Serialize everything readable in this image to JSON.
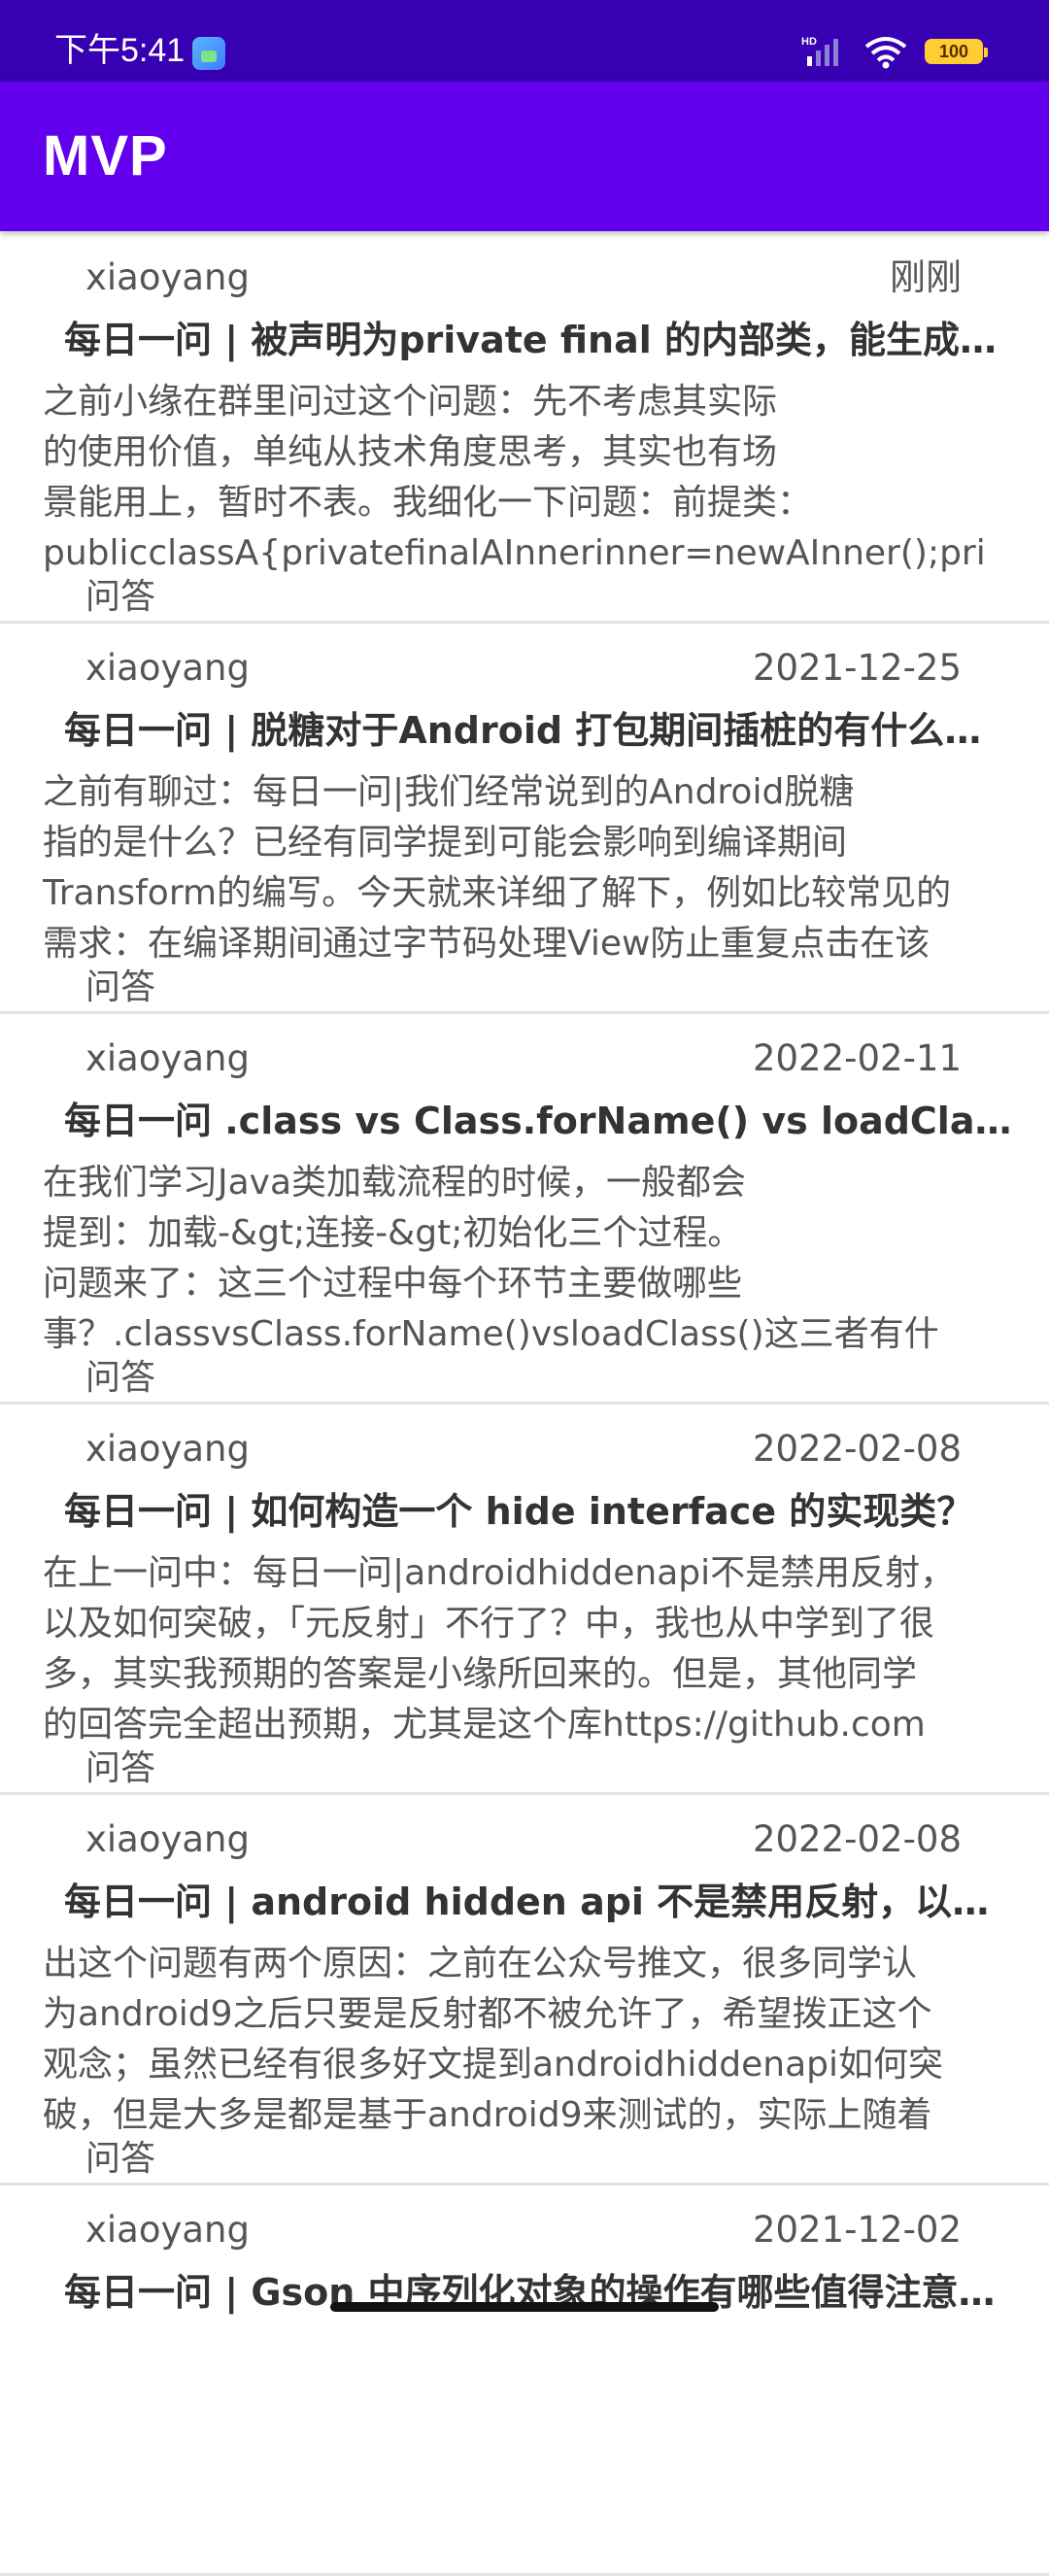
{
  "status_bar": {
    "time": "下午5:41",
    "network": "HD",
    "battery": "100"
  },
  "app_bar": {
    "title": "MVP"
  },
  "items": [
    {
      "author": "xiaoyang",
      "date": "刚刚",
      "title": "每日一问 | 被声明为private final 的内部类，能生成…",
      "desc_lines": [
        "之前小缘在群里问过这个问题：先不考虑其实际",
        "的使用价值，单纯从技术角度思考，其实也有场",
        "景能用上，暂时不表。我细化一下问题：前提类：",
        "publicclassA{privatefinalAInnerinner=newAInner();pri"
      ],
      "tag": "问答"
    },
    {
      "author": "xiaoyang",
      "date": "2021-12-25",
      "title": "每日一问 | 脱糖对于Android 打包期间插桩的有什么…",
      "desc_lines": [
        "之前有聊过：每日一问|我们经常说到的Android脱糖",
        "指的是什么？已经有同学提到可能会影响到编译期间",
        "Transform的编写。今天就来详细了解下，例如比较常见的",
        "需求：在编译期间通过字节码处理View防止重复点击在该"
      ],
      "tag": "问答"
    },
    {
      "author": "xiaoyang",
      "date": "2022-02-11",
      "title": "每日一问 .class vs Class.forName() vs loadClass…",
      "desc_lines": [
        "在我们学习Java类加载流程的时候，一般都会",
        "提到：加载-&gt;连接-&gt;初始化三个过程。",
        "问题来了：这三个过程中每个环节主要做哪些",
        "事？.classvsClass.forName()vsloadClass()这三者有什"
      ],
      "tag": "问答"
    },
    {
      "author": "xiaoyang",
      "date": "2022-02-08",
      "title": "每日一问 | 如何构造一个 hide interface 的实现类？",
      "desc_lines": [
        "在上一问中：每日一问|androidhiddenapi不是禁用反射，",
        "以及如何突破，「元反射」不行了？中，我也从中学到了很",
        "多，其实我预期的答案是小缘所回来的。但是，其他同学",
        "的回答完全超出预期，尤其是这个库https://github.com"
      ],
      "tag": "问答"
    },
    {
      "author": "xiaoyang",
      "date": "2022-02-08",
      "title": "每日一问 | android hidden api 不是禁用反射，以及…",
      "desc_lines": [
        "出这个问题有两个原因：之前在公众号推文，很多同学认",
        "为android9之后只要是反射都不被允许了，希望拨正这个",
        "观念；虽然已经有很多好文提到androidhiddenapi如何突",
        "破，但是大多是都是基于android9来测试的，实际上随着"
      ],
      "tag": "问答"
    },
    {
      "author": "xiaoyang",
      "date": "2021-12-02",
      "title": "每日一问 | Gson 中序列化对象的操作有哪些值得注意的…",
      "desc_lines": [],
      "tag": ""
    }
  ]
}
